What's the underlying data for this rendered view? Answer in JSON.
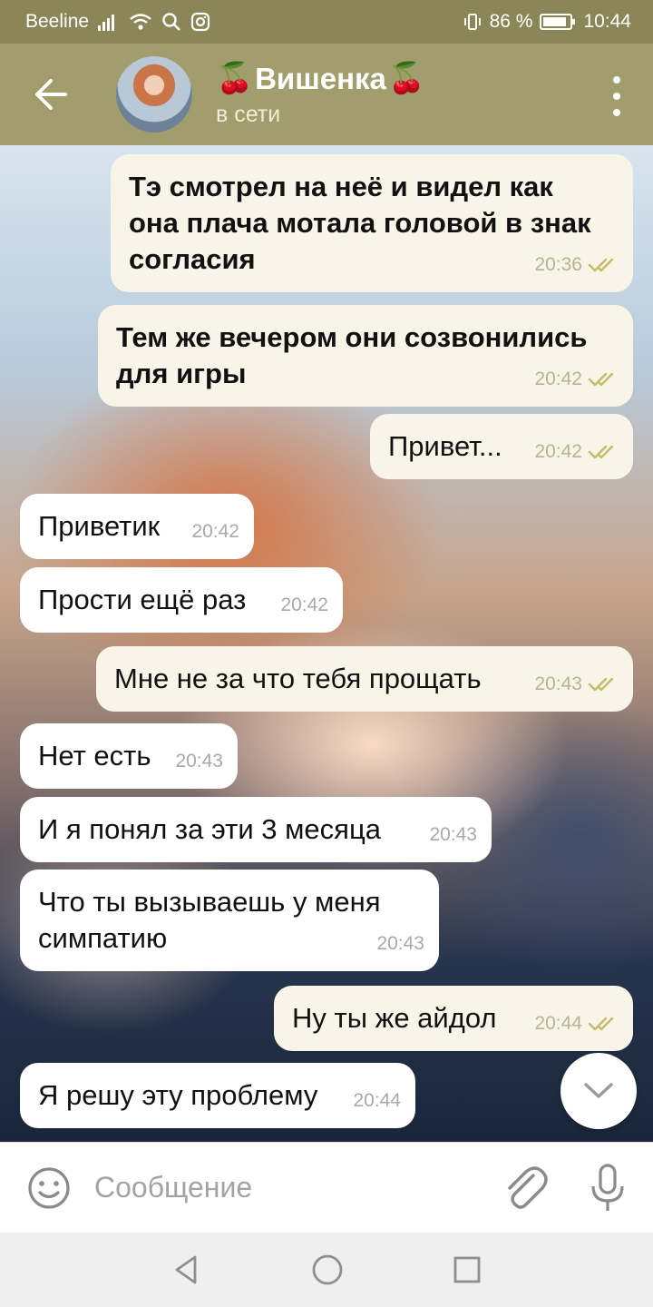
{
  "status_bar": {
    "carrier": "Beeline",
    "battery": "86 %",
    "time": "10:44"
  },
  "header": {
    "name": "Вишенка",
    "status": "в сети",
    "name_emoji": "🍒"
  },
  "messages": [
    {
      "direction": "out",
      "text": "Тэ смотрел на неё и видел как\nона плача мотала головой в знак\nсогласия",
      "time": "20:36",
      "read": true,
      "bold": true
    },
    {
      "direction": "out",
      "text": "Тем же вечером они созвонились\nдля игры",
      "time": "20:42",
      "read": true,
      "bold": true
    },
    {
      "direction": "out",
      "text": "Привет...",
      "time": "20:42",
      "read": true,
      "bold": false
    },
    {
      "direction": "in",
      "text": "Приветик",
      "time": "20:42"
    },
    {
      "direction": "in",
      "text": "Прости ещё раз",
      "time": "20:42"
    },
    {
      "direction": "out",
      "text": "Мне не за что тебя прощать",
      "time": "20:43",
      "read": true,
      "bold": false
    },
    {
      "direction": "in",
      "text": "Нет есть",
      "time": "20:43"
    },
    {
      "direction": "in",
      "text": "И я понял за эти 3 месяца",
      "time": "20:43"
    },
    {
      "direction": "in",
      "text": "Что ты вызываешь у меня\nсимпатию",
      "time": "20:43"
    },
    {
      "direction": "out",
      "text": "Ну ты же айдол",
      "time": "20:44",
      "read": true,
      "bold": false
    },
    {
      "direction": "in",
      "text": "Я решу эту проблему",
      "time": "20:44"
    }
  ],
  "input": {
    "placeholder": "Сообщение"
  },
  "colors": {
    "header": "#a19d6c",
    "status_bar": "#8b8658",
    "bubble_out": "#f8f5e8",
    "bubble_in": "#ffffff",
    "read_check": "#c4bb6a"
  },
  "icons": {
    "back": "arrow-left-icon",
    "menu": "more-vertical-icon",
    "emoji": "smile-icon",
    "attach": "paperclip-icon",
    "mic": "microphone-icon",
    "scroll": "chevron-down-icon"
  }
}
